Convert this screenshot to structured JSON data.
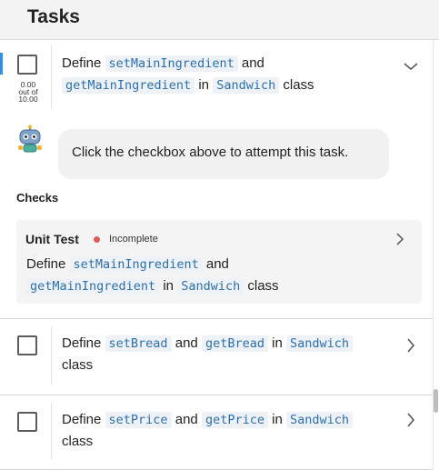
{
  "header": {
    "title": "Tasks"
  },
  "tasks": [
    {
      "prefix": "Define ",
      "code1": "setMainIngredient",
      "mid1": " and ",
      "code2": "getMainIngredient",
      "mid2": " in ",
      "code3": "Sandwich",
      "suffix": " class",
      "score": {
        "value": "0.00",
        "outof": "out of",
        "max": "10.00"
      },
      "expanded": true,
      "robot_message": "Click the checkbox above to attempt this task.",
      "checks_label": "Checks",
      "unit_test": {
        "title": "Unit Test",
        "status": "Incomplete",
        "status_color": "#e05a5a",
        "prefix": "Define ",
        "code1": "setMainIngredient",
        "mid1": " and ",
        "code2": "getMainIngredient",
        "mid2": " in ",
        "code3": "Sandwich",
        "suffix": " class"
      }
    },
    {
      "prefix": "Define ",
      "code1": "setBread",
      "mid1": " and ",
      "code2": "getBread",
      "mid2": " in ",
      "code3": "Sandwich",
      "suffix": " class"
    },
    {
      "prefix": "Define ",
      "code1": "setPrice",
      "mid1": " and ",
      "code2": "getPrice",
      "mid2": " in ",
      "code3": "Sandwich",
      "suffix": " class"
    }
  ],
  "icons": {
    "expand": "chevron-down-icon",
    "collapsed": "chevron-right-icon",
    "robot": "robot-avatar-icon"
  },
  "colors": {
    "accent": "#2d8fe6",
    "code_text": "#2b6fb0",
    "code_bg": "#eef2f6",
    "incomplete": "#e05a5a"
  }
}
